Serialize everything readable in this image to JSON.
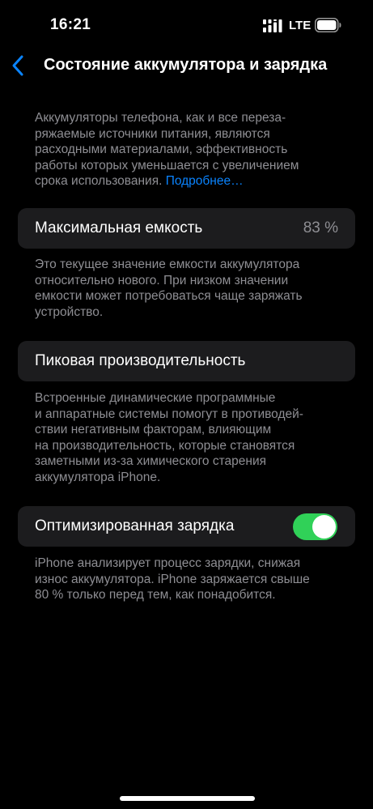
{
  "status_bar": {
    "time": "16:21",
    "network": "LTE",
    "signal_icon": "signal-bars-icon",
    "battery_icon": "battery-icon"
  },
  "nav": {
    "back_icon": "chevron-left-icon",
    "title": "Состояние аккумулятора и зарядка"
  },
  "intro": {
    "lines": [
      "Аккумуляторы телефона, как и все переза-",
      "ряжаемые источники питания, являются",
      "расходными материалами, эффективность",
      "работы которых уменьшается с увеличением",
      "срока использования."
    ],
    "link": "Подробнее…"
  },
  "max_capacity": {
    "label": "Максимальная емкость",
    "value": "83 %",
    "description": [
      "Это текущее значение емкости аккумулятора",
      "относительно нового. При низком значении",
      "емкости может потребоваться чаще заряжать",
      "устройство."
    ]
  },
  "peak_performance": {
    "label": "Пиковая производительность",
    "description": [
      "Встроенные динамические программные",
      "и аппаратные системы помогут в противодей-",
      "ствии негативным факторам, влияющим",
      "на производительность, которые становятся",
      "заметными из-за химического старения",
      "аккумулятора iPhone."
    ]
  },
  "optimized_charging": {
    "label": "Оптимизированная зарядка",
    "enabled": true,
    "description": [
      "iPhone анализирует процесс зарядки, снижая",
      "износ аккумулятора. iPhone заряжается свыше",
      "80 % только перед тем, как понадобится."
    ]
  },
  "colors": {
    "background": "#000000",
    "card": "#1c1c1e",
    "secondary_text": "#8e8e93",
    "link": "#0a84ff",
    "toggle_on": "#30d158"
  }
}
